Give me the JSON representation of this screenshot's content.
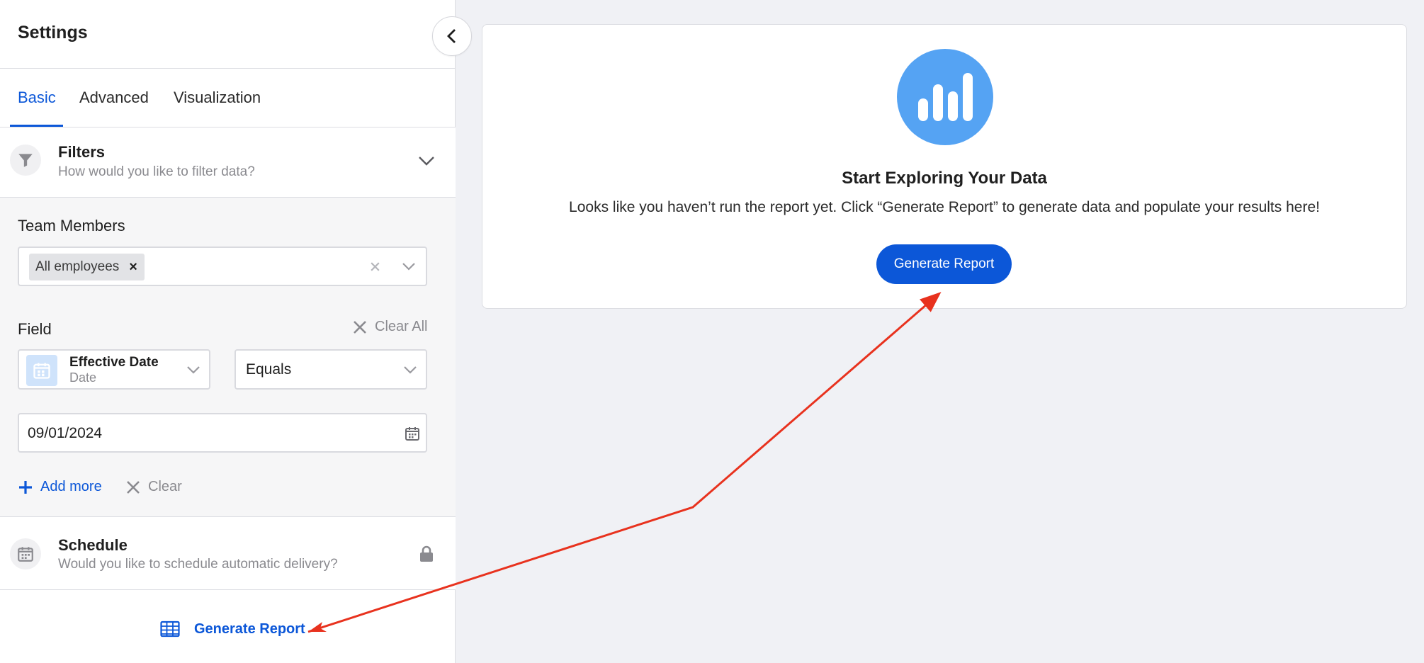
{
  "sidebar": {
    "title": "Settings",
    "tabs": [
      {
        "label": "Basic",
        "active": true
      },
      {
        "label": "Advanced",
        "active": false
      },
      {
        "label": "Visualization",
        "active": false
      }
    ],
    "filters": {
      "title": "Filters",
      "subtitle": "How would you like to filter data?",
      "team_members_label": "Team Members",
      "team_chip": "All employees",
      "field_label": "Field",
      "clear_all_label": "Clear All",
      "field_name": "Effective Date",
      "field_type": "Date",
      "operator": "Equals",
      "date_value": "09/01/2024",
      "add_more_label": "Add more",
      "clear_label": "Clear"
    },
    "schedule": {
      "title": "Schedule",
      "subtitle": "Would you like to schedule automatic delivery?"
    },
    "generate_label": "Generate Report"
  },
  "main": {
    "title": "Start Exploring Your Data",
    "description": "Looks like you haven’t run the report yet. Click “Generate Report” to generate data and populate your results here!",
    "button_label": "Generate Report"
  },
  "colors": {
    "accent": "#0c57d8",
    "icon_circle": "#55a3f3",
    "annotation": "#e8321e"
  }
}
